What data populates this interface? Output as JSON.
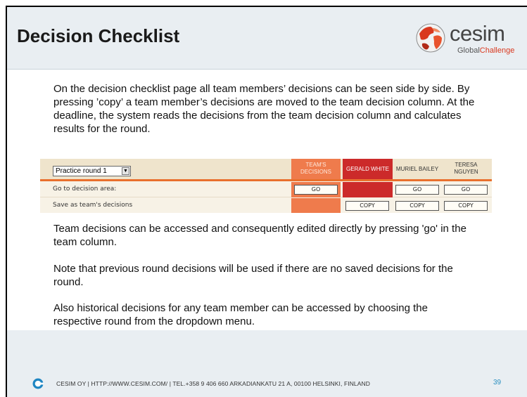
{
  "slide": {
    "title": "Decision Checklist",
    "logo": {
      "word": "cesim",
      "sub_global": "Global",
      "sub_challenge": "Challenge"
    },
    "paragraphs": [
      "On the decision checklist page all team members’ decisions can be seen side by side. By pressing ’copy’ a team member’s decisions are moved to the team decision column. At the deadline, the system reads the decisions from the team decision column and calculates results for the round.",
      "Team decisions can be accessed and consequently edited directly by pressing 'go' in the team column.",
      "Note that previous round decisions will be used if there are no saved decisions for the round.",
      "Also historical decisions for any team member can be accessed by choosing the respective round from the dropdown menu."
    ],
    "footer": {
      "text": "CESIM OY | HTTP://WWW.CESIM.COM/ | TEL.+358 9 406 660   ARKADIANKATU 21 A, 00100 HELSINKI, FINLAND",
      "page_number": "39"
    }
  },
  "checklist": {
    "round_select": {
      "selected": "Practice round 1"
    },
    "columns": {
      "team_line1": "TEAM'S",
      "team_line2": "DECISIONS",
      "gerald": "GERALD WHITE",
      "muriel": "MURIEL BAILEY",
      "teresa_line1": "TERESA",
      "teresa_line2": "NGUYEN"
    },
    "rows": {
      "go_label": "Go to decision area:",
      "save_label": "Save as team's decisions"
    },
    "buttons": {
      "go": "GO",
      "copy": "COPY"
    }
  },
  "colors": {
    "header_bg": "#e9eef2",
    "team_col": "#ef7b4c",
    "gerald_col": "#cc2a2a",
    "accent_orange": "#e9702d",
    "page_number": "#2a8fc0",
    "logo_accent": "#d9381e"
  },
  "icons": {
    "logo": "cesim-globe-icon",
    "footer": "cesim-circle-icon",
    "dropdown": "chevron-down-icon"
  }
}
